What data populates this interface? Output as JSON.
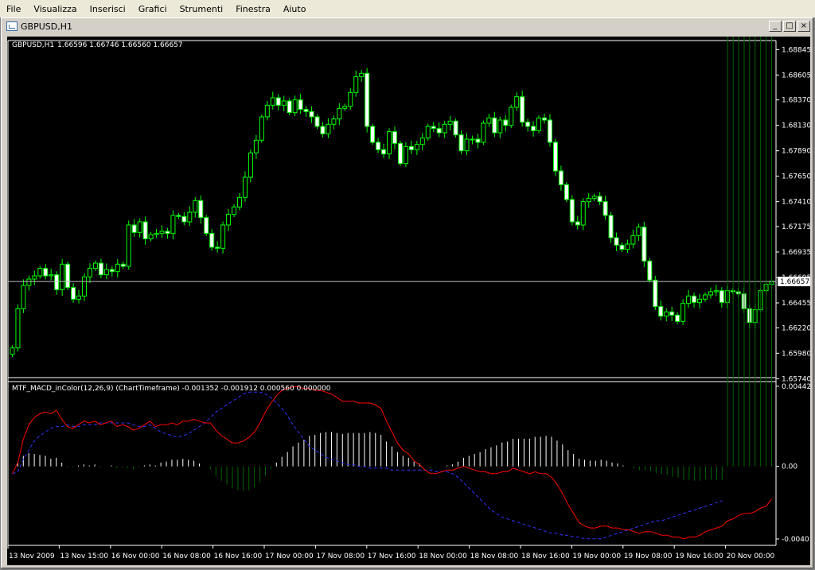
{
  "menu": [
    "File",
    "Visualizza",
    "Inserisci",
    "Grafici",
    "Strumenti",
    "Finestra",
    "Aiuto"
  ],
  "window": {
    "title": "GBPUSD,H1",
    "min_glyph": "_",
    "max_glyph": "□",
    "close_glyph": "×"
  },
  "colors": {
    "background": "#000000",
    "bull": "#00ff00",
    "bear": "#ffffff",
    "macd_line": "#ff0000",
    "signal_line": "#3333ff",
    "hist_pos": "#ffffff",
    "hist_neg": "#006600",
    "grid_text": "#ffffff"
  },
  "chart_data": [
    {
      "type": "candlestick",
      "title": "GBPUSD,H1",
      "ohlc_label": "1.66596 1.66746 1.66560 1.66657",
      "ylim": [
        1.6575,
        1.6893
      ],
      "ytick_labels": [
        "1.68845",
        "1.68605",
        "1.68370",
        "1.68130",
        "1.67890",
        "1.67650",
        "1.67410",
        "1.67175",
        "1.66935",
        "1.66695",
        "1.66455",
        "1.66220",
        "1.65980",
        "1.65740"
      ],
      "last_price": "1.66657",
      "close": [
        1.6603,
        1.664,
        1.6662,
        1.6668,
        1.6671,
        1.6678,
        1.6671,
        1.6672,
        1.6658,
        1.6682,
        1.666,
        1.6649,
        1.6652,
        1.667,
        1.6678,
        1.6683,
        1.6672,
        1.6677,
        1.6675,
        1.6682,
        1.668,
        1.6719,
        1.6712,
        1.6722,
        1.6706,
        1.671,
        1.6711,
        1.6713,
        1.6711,
        1.6728,
        1.6727,
        1.6722,
        1.6731,
        1.6742,
        1.6726,
        1.6711,
        1.6698,
        1.6697,
        1.6719,
        1.6729,
        1.6736,
        1.6745,
        1.6764,
        1.6787,
        1.6799,
        1.6821,
        1.6832,
        1.6839,
        1.6832,
        1.6836,
        1.6825,
        1.6837,
        1.6828,
        1.6826,
        1.6821,
        1.6812,
        1.6805,
        1.6814,
        1.6819,
        1.6829,
        1.6831,
        1.6844,
        1.6859,
        1.6862,
        1.6812,
        1.6797,
        1.679,
        1.6786,
        1.6807,
        1.6796,
        1.6777,
        1.6793,
        1.679,
        1.6795,
        1.6801,
        1.6812,
        1.681,
        1.6806,
        1.6814,
        1.6817,
        1.6804,
        1.6789,
        1.68,
        1.68,
        1.6797,
        1.6815,
        1.682,
        1.6806,
        1.6818,
        1.6813,
        1.683,
        1.684,
        1.6816,
        1.6812,
        1.6808,
        1.682,
        1.6818,
        1.6797,
        1.677,
        1.6757,
        1.6743,
        1.6722,
        1.6719,
        1.6741,
        1.6744,
        1.6746,
        1.6741,
        1.6728,
        1.6707,
        1.67,
        1.6696,
        1.6701,
        1.6709,
        1.6717,
        1.6685,
        1.6667,
        1.6642,
        1.6633,
        1.6637,
        1.6634,
        1.6628,
        1.6645,
        1.6652,
        1.6646,
        1.6649,
        1.6653,
        1.6656,
        1.6657,
        1.6646,
        1.6657,
        1.6656,
        1.6654,
        1.664,
        1.6627,
        1.6639,
        1.6657,
        1.6663,
        1.6666
      ],
      "series": [
        {
          "name": "MTF_MACD_inColor(12,26,9) (ChartTimeframe)"
        }
      ]
    },
    {
      "type": "macd",
      "label": "MTF_MACD_inColor(12,26,9) (ChartTimeframe) -0.001352 -0.001912 0.000560 0.000000",
      "ylim": [
        -0.00401,
        0.00442
      ],
      "ytick_labels": [
        "0.004425",
        "0.00",
        "-0.00401"
      ],
      "macd": [
        -0.0004,
        0.0002,
        0.0015,
        0.0023,
        0.0027,
        0.0029,
        0.003,
        0.0029,
        0.0031,
        0.0026,
        0.0022,
        0.0021,
        0.0023,
        0.0025,
        0.0024,
        0.0025,
        0.0023,
        0.0024,
        0.0025,
        0.0022,
        0.0023,
        0.0022,
        0.002,
        0.0021,
        0.0023,
        0.0025,
        0.0022,
        0.0023,
        0.0023,
        0.0024,
        0.0023,
        0.0025,
        0.0025,
        0.0026,
        0.0025,
        0.0024,
        0.0024,
        0.002,
        0.0017,
        0.0015,
        0.0013,
        0.0013,
        0.0014,
        0.0016,
        0.0019,
        0.0024,
        0.003,
        0.0035,
        0.0039,
        0.0042,
        0.0043,
        0.0044,
        0.0044,
        0.0043,
        0.0043,
        0.0042,
        0.0042,
        0.0041,
        0.004,
        0.0038,
        0.0036,
        0.0036,
        0.0036,
        0.0035,
        0.0035,
        0.0035,
        0.0034,
        0.0032,
        0.0025,
        0.0019,
        0.0013,
        0.0009,
        0.0007,
        0.0003,
        0.0001,
        -0.0002,
        -0.0004,
        -0.0004,
        -0.0003,
        -0.0002,
        -0.0002,
        -0.0001,
        0.0,
        -0.0001,
        -0.0002,
        -0.0003,
        -0.0003,
        -0.0004,
        -0.0004,
        -0.0003,
        -0.0003,
        -0.0001,
        -0.0002,
        -0.0003,
        -0.0004,
        -0.0003,
        -0.0004,
        -0.0004,
        -0.0006,
        -0.001,
        -0.0015,
        -0.0021,
        -0.0026,
        -0.0031,
        -0.0033,
        -0.0034,
        -0.0034,
        -0.0033,
        -0.0033,
        -0.0034,
        -0.0034,
        -0.0035,
        -0.0035,
        -0.0036,
        -0.0037,
        -0.0036,
        -0.0036,
        -0.0037,
        -0.0038,
        -0.0038,
        -0.0039,
        -0.0039,
        -0.004,
        -0.0039,
        -0.0039,
        -0.0038,
        -0.0036,
        -0.0035,
        -0.0034,
        -0.0033,
        -0.003,
        -0.0029,
        -0.0027,
        -0.0026,
        -0.0026,
        -0.0025,
        -0.0023,
        -0.0022,
        -0.0018
      ],
      "signal": [
        -0.0004,
        -0.0003,
        0.0004,
        0.0009,
        0.0014,
        0.0017,
        0.0019,
        0.0021,
        0.0022,
        0.0022,
        0.0023,
        0.0022,
        0.0022,
        0.0023,
        0.0023,
        0.0023,
        0.0024,
        0.0024,
        0.0024,
        0.0024,
        0.0024,
        0.0024,
        0.0023,
        0.0022,
        0.0022,
        0.0023,
        0.0021,
        0.0019,
        0.0018,
        0.0017,
        0.0016,
        0.0017,
        0.0018,
        0.002,
        0.0022,
        0.0024,
        0.0027,
        0.003,
        0.0032,
        0.0034,
        0.0036,
        0.0038,
        0.004,
        0.0041,
        0.0041,
        0.0041,
        0.004,
        0.0038,
        0.0035,
        0.0032,
        0.0028,
        0.0023,
        0.0019,
        0.0015,
        0.0011,
        0.0009,
        0.0007,
        0.0005,
        0.0004,
        0.0003,
        0.0002,
        0.0001,
        0.0001,
        0.0,
        0.0,
        -0.0001,
        -0.0001,
        -0.0001,
        -0.0001,
        -0.0002,
        -0.0002,
        -0.0002,
        -0.0002,
        -0.0002,
        -0.0002,
        -0.0002,
        -0.0002,
        -0.0003,
        -0.0003,
        -0.0003,
        -0.0004,
        -0.0006,
        -0.0009,
        -0.0012,
        -0.0015,
        -0.0018,
        -0.0021,
        -0.0024,
        -0.0026,
        -0.0028,
        -0.0029,
        -0.003,
        -0.0031,
        -0.0032,
        -0.0033,
        -0.0034,
        -0.0035,
        -0.0036,
        -0.0037,
        -0.0037,
        -0.0038,
        -0.0038,
        -0.0039,
        -0.0039,
        -0.004,
        -0.004,
        -0.004,
        -0.004,
        -0.0039,
        -0.0038,
        -0.0037,
        -0.0036,
        -0.0035,
        -0.0034,
        -0.0033,
        -0.0032,
        -0.0031,
        -0.003,
        -0.003,
        -0.0029,
        -0.0028,
        -0.0027,
        -0.0026,
        -0.0025,
        -0.0024,
        -0.0023,
        -0.0022,
        -0.0021,
        -0.002,
        -0.0019
      ]
    }
  ],
  "x_labels": [
    "13 Nov 2009",
    "13 Nov 15:00",
    "16 Nov 00:00",
    "16 Nov 08:00",
    "16 Nov 16:00",
    "17 Nov 00:00",
    "17 Nov 08:00",
    "17 Nov 16:00",
    "18 Nov 00:00",
    "18 Nov 08:00",
    "18 Nov 16:00",
    "19 Nov 00:00",
    "19 Nov 08:00",
    "19 Nov 16:00",
    "20 Nov 00:00"
  ]
}
